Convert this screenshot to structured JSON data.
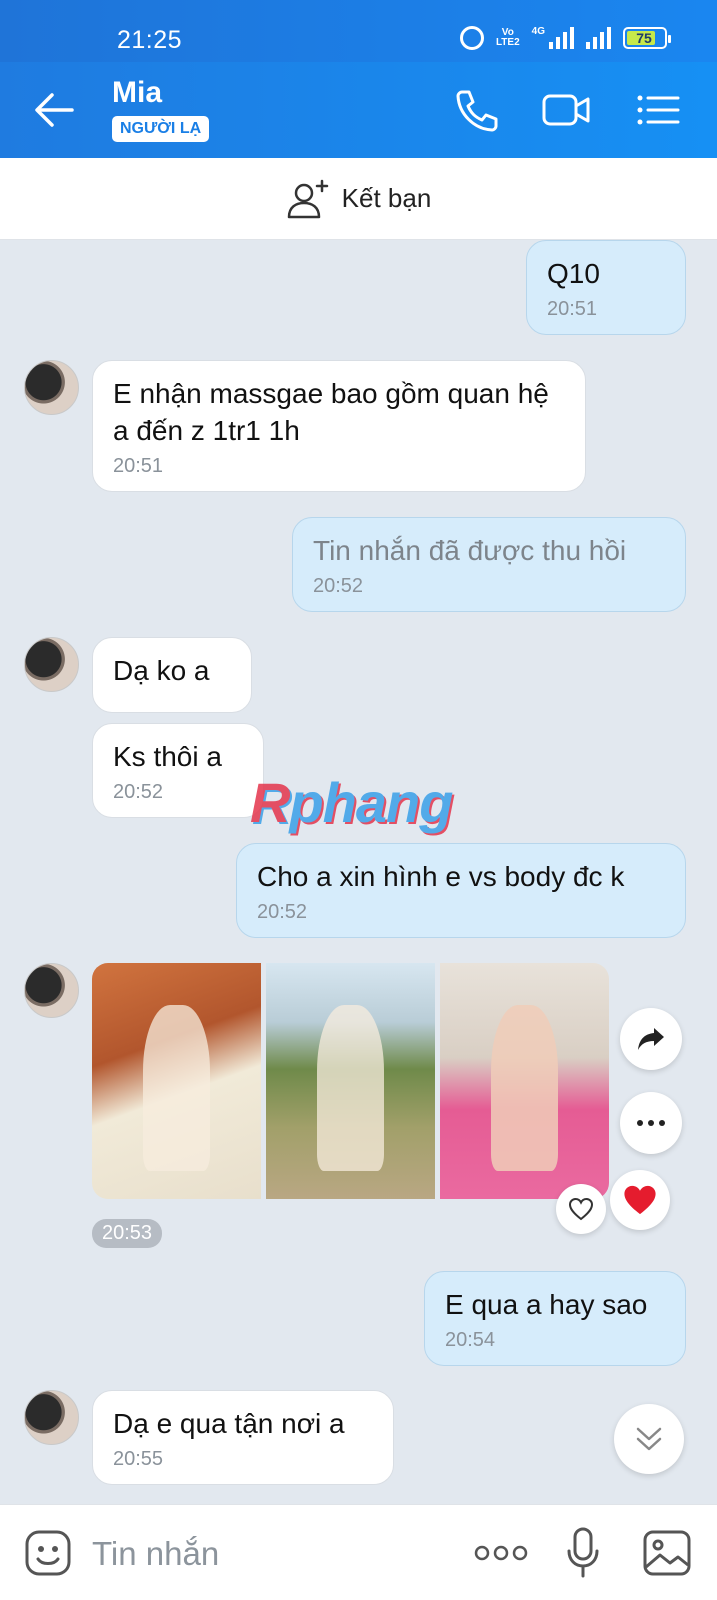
{
  "status_bar": {
    "time": "21:25",
    "battery": "75",
    "network": "4G",
    "volte": "Vo LTE2"
  },
  "header": {
    "name": "Mia",
    "badge": "NGƯỜI LẠ"
  },
  "friend_bar": {
    "label": "Kết bạn"
  },
  "messages": [
    {
      "side": "out",
      "text": "Q10",
      "time": "20:51"
    },
    {
      "side": "in",
      "text": "E nhận massgae bao gồm quan hệ a đến z 1tr1 1h",
      "time": "20:51"
    },
    {
      "side": "out",
      "text": "Tin nhắn đã được thu hồi",
      "time": "20:52",
      "recalled": true
    },
    {
      "side": "in",
      "text": "Dạ ko a",
      "time": ""
    },
    {
      "side": "in",
      "text": "Ks thôi a",
      "time": "20:52"
    },
    {
      "side": "out",
      "text": "Cho a xin hình e vs body đc k",
      "time": "20:52"
    },
    {
      "side": "in",
      "type": "photos",
      "count": 3,
      "time": "20:53"
    },
    {
      "side": "out",
      "text": "E qua a hay sao",
      "time": "20:54"
    },
    {
      "side": "in",
      "text": "Dạ e qua tận nơi a",
      "time": "20:55"
    }
  ],
  "watermark": {
    "first": "R",
    "rest": "phang"
  },
  "composer": {
    "placeholder": "Tin nhắn"
  },
  "icons": [
    "back-arrow-icon",
    "phone-icon",
    "video-call-icon",
    "menu-icon",
    "add-friend-icon",
    "share-icon",
    "more-icon",
    "heart-icon",
    "scroll-down-icon",
    "emoji-icon",
    "mic-icon",
    "image-icon"
  ],
  "colors": {
    "header": "#1a86f0",
    "bubble_out": "#d6ecfb",
    "bubble_in": "#ffffff",
    "background": "#e2e8ef"
  }
}
